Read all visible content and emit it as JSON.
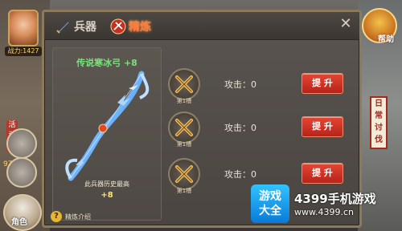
{
  "sidebar_left": {
    "level_text": "战力:1427",
    "tab_label": "活动",
    "badge_number": "97",
    "role_label": "角色"
  },
  "sidebar_right": {
    "help_label": "帮助",
    "banner_text": "日常讨伐"
  },
  "dialog": {
    "tabs": [
      {
        "label": "兵器",
        "icon": "sword-icon"
      },
      {
        "label": "精炼",
        "icon": "refine-icon"
      }
    ],
    "active_tab": "精炼",
    "close_label": "✕",
    "weapon": {
      "name": "传说寒冰弓 +8",
      "history_label": "此兵器历史最高",
      "history_value": "+8"
    },
    "slots": [
      {
        "label": "第1槽",
        "attack_text": "攻击：0",
        "button": "提 升"
      },
      {
        "label": "第1槽",
        "attack_text": "攻击：0",
        "button": "提 升"
      },
      {
        "label": "第1槽",
        "attack_text": "攻击：0",
        "button": "提 升"
      }
    ],
    "help_text": "精炼介绍"
  },
  "watermark": {
    "logo_text_line1": "游戏",
    "logo_text_line2": "大全",
    "title": "4399手机游戏",
    "url": "www.4399.cn"
  }
}
